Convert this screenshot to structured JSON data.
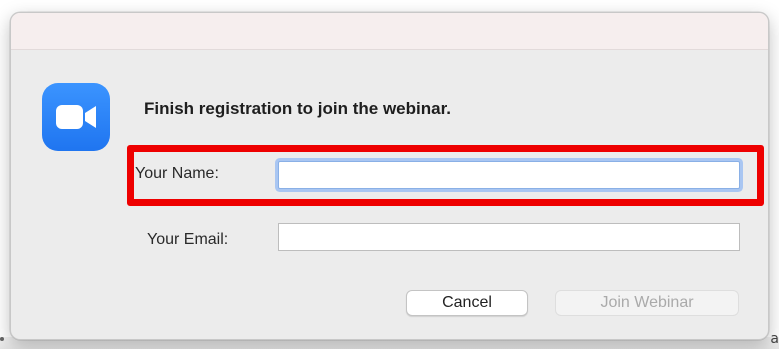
{
  "dialog": {
    "heading": "Finish registration to join the webinar.",
    "app_icon": "zoom-video-camera-icon"
  },
  "form": {
    "name_label": "Your Name:",
    "name_value": "",
    "email_label": "Your Email:",
    "email_value": ""
  },
  "buttons": {
    "cancel": "Cancel",
    "join": "Join Webinar"
  },
  "colors": {
    "icon_blue": "#2d8cff",
    "highlight_red": "#ee0000",
    "focus_ring": "#a9c6f2"
  }
}
